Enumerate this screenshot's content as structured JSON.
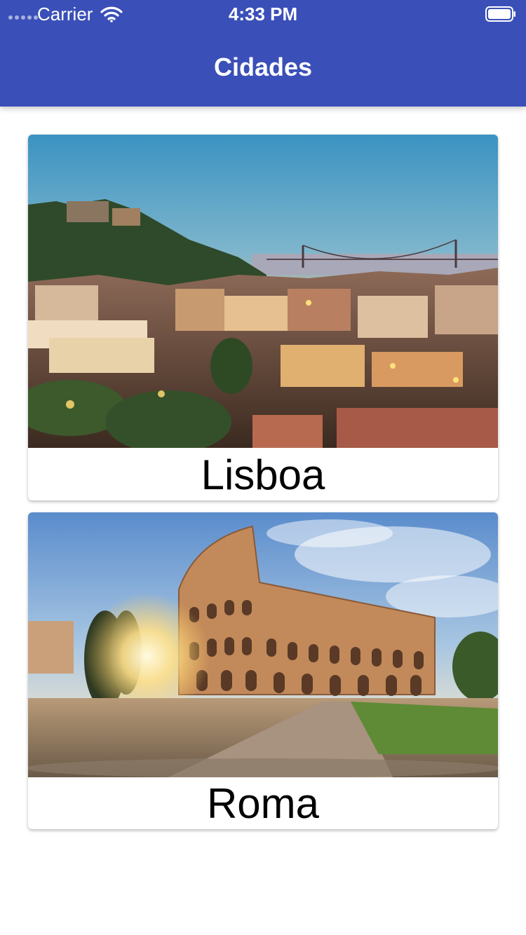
{
  "status_bar": {
    "carrier": "Carrier",
    "time": "4:33 PM"
  },
  "nav": {
    "title": "Cidades"
  },
  "cities": [
    {
      "name": "Lisboa",
      "image": "lisbon-sunset-photo"
    },
    {
      "name": "Roma",
      "image": "rome-colosseum-photo"
    }
  ],
  "colors": {
    "nav_background": "#3a4fb8",
    "page_background": "#ffffff",
    "card_text": "#000000",
    "header_text": "#ffffff"
  },
  "icons": [
    "signal-icon",
    "wifi-icon",
    "battery-icon"
  ]
}
